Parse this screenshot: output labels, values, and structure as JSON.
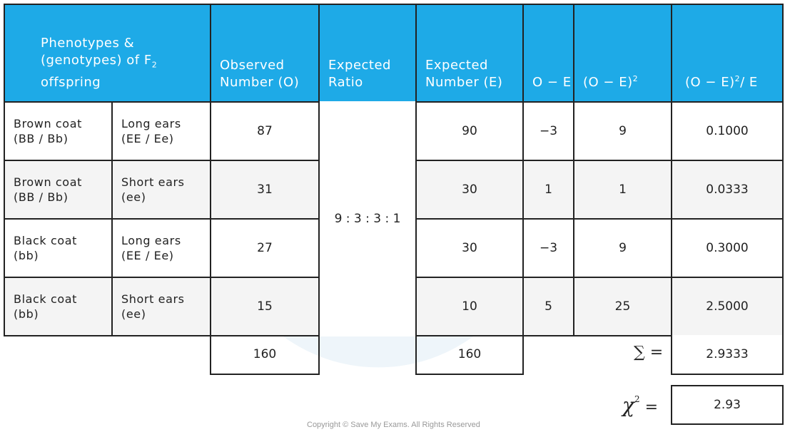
{
  "headers": {
    "phenotypes_line1": "Phenotypes &",
    "phenotypes_line2": "(genotypes) of F",
    "phenotypes_sub": "2",
    "phenotypes_line3": "offspring",
    "observed_line1": "Observed",
    "observed_line2": "Number (O)",
    "ratio_line1": "Expected",
    "ratio_line2": "Ratio",
    "expected_line1": "Expected",
    "expected_line2": "Number (E)",
    "o_minus_e": "O − E",
    "o_minus_e_sq": "(O − E)",
    "o_minus_e_sq_sup": "2",
    "chi_term_a": "(O − E)",
    "chi_term_sup": "2",
    "chi_term_b": "/ E"
  },
  "rows": [
    {
      "coat1": "Brown coat",
      "coat2": "(BB / Bb)",
      "ears1": "Long ears",
      "ears2": "(EE / Ee)",
      "observed": "87",
      "expected": "90",
      "o_minus_e": "−3",
      "sq": "9",
      "chi": "0.1000"
    },
    {
      "coat1": "Brown coat",
      "coat2": "(BB / Bb)",
      "ears1": "Short ears",
      "ears2": "(ee)",
      "observed": "31",
      "expected": "30",
      "o_minus_e": "1",
      "sq": "1",
      "chi": "0.0333"
    },
    {
      "coat1": "Black coat",
      "coat2": "(bb)",
      "ears1": "Long ears",
      "ears2": "(EE / Ee)",
      "observed": "27",
      "expected": "30",
      "o_minus_e": "−3",
      "sq": "9",
      "chi": "0.3000"
    },
    {
      "coat1": "Black  coat",
      "coat2": "(bb)",
      "ears1": "Short ears",
      "ears2": "(ee)",
      "observed": "15",
      "expected": "10",
      "o_minus_e": "5",
      "sq": "25",
      "chi": "2.5000"
    }
  ],
  "ratio": "9 : 3 : 3 : 1",
  "totals": {
    "observed": "160",
    "expected": "160",
    "sum_label": "∑ =",
    "sum_value": "2.9333"
  },
  "chi_square": {
    "label": "χ",
    "label_sup": "2",
    "equals": "=",
    "value": "2.93"
  },
  "copyright": "Copyright © Save My Exams. All Rights Reserved",
  "colors": {
    "header_bg": "#1eaae7",
    "alt_row": "#f4f4f4"
  }
}
